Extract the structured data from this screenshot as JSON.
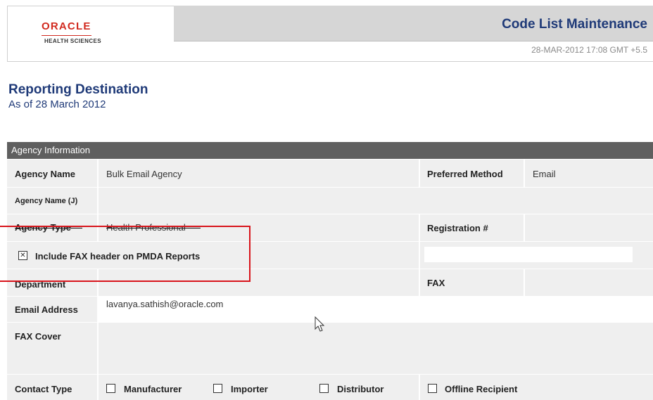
{
  "header": {
    "logo_brand": "ORACLE",
    "logo_sub": "HEALTH SCIENCES",
    "app_title": "Code List Maintenance",
    "timestamp": "28-MAR-2012 17:08 GMT +5.5"
  },
  "page": {
    "title": "Reporting Destination",
    "subtitle": "As of 28 March 2012"
  },
  "section": {
    "title": "Agency Information"
  },
  "fields": {
    "agency_name_label": "Agency Name",
    "agency_name_value": "Bulk Email Agency",
    "preferred_method_label": "Preferred Method",
    "preferred_method_value": "Email",
    "agency_name_j_label": "Agency Name (J)",
    "agency_type_label": "Agency Type",
    "agency_type_value": "Health Professional",
    "registration_label": "Registration #",
    "fax_header_label": "Include FAX header on PMDA Reports",
    "fax_header_checked": true,
    "department_label": "Department",
    "fax_label": "FAX",
    "email_label": "Email Address",
    "email_value": "lavanya.sathish@oracle.com",
    "fax_cover_label": "FAX Cover",
    "contact_type_label": "Contact Type",
    "contact_options": [
      "Manufacturer",
      "Importer",
      "Distributor",
      "Offline Recipient"
    ]
  },
  "colors": {
    "brand_red": "#d12a1f",
    "title_blue": "#1f3a78",
    "highlight_red": "#d8141b",
    "section_grey": "#5f5f5f"
  },
  "icons": {
    "cursor": "mouse-pointer-icon",
    "checkbox_checked": "checkbox-checked-icon",
    "checkbox_unchecked": "checkbox-unchecked-icon"
  }
}
